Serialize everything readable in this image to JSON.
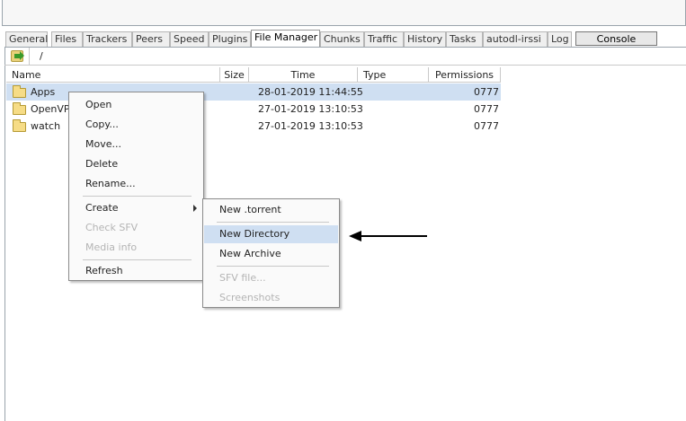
{
  "tabs": [
    {
      "label": "General"
    },
    {
      "label": "Files"
    },
    {
      "label": "Trackers"
    },
    {
      "label": "Peers"
    },
    {
      "label": "Speed"
    },
    {
      "label": "Plugins"
    },
    {
      "label": "File Manager"
    },
    {
      "label": "Chunks"
    },
    {
      "label": "Traffic"
    },
    {
      "label": "History"
    },
    {
      "label": "Tasks"
    },
    {
      "label": "autodl-irssi"
    },
    {
      "label": "Log"
    },
    {
      "label": "Console"
    }
  ],
  "active_tab": "File Manager",
  "path": "/",
  "columns": [
    "Name",
    "Size",
    "Time",
    "Type",
    "Permissions"
  ],
  "rows": [
    {
      "name": "Apps",
      "time": "28-01-2019 11:44:55",
      "permissions": "0777"
    },
    {
      "name": "OpenVP",
      "time": "27-01-2019 13:10:53",
      "permissions": "0777"
    },
    {
      "name": "watch",
      "time": "27-01-2019 13:10:53",
      "permissions": "0777"
    }
  ],
  "context_menu": {
    "items": [
      "Open",
      "Copy...",
      "Move...",
      "Delete",
      "Rename...",
      "Create",
      "Check SFV",
      "Media info",
      "Refresh"
    ]
  },
  "submenu": {
    "items": [
      "New .torrent",
      "New Directory",
      "New Archive",
      "SFV file...",
      "Screenshots"
    ]
  },
  "colors": {
    "selection": "#cfdff2",
    "disabled_text": "#b4b4b4",
    "border": "#9aa4ac"
  }
}
